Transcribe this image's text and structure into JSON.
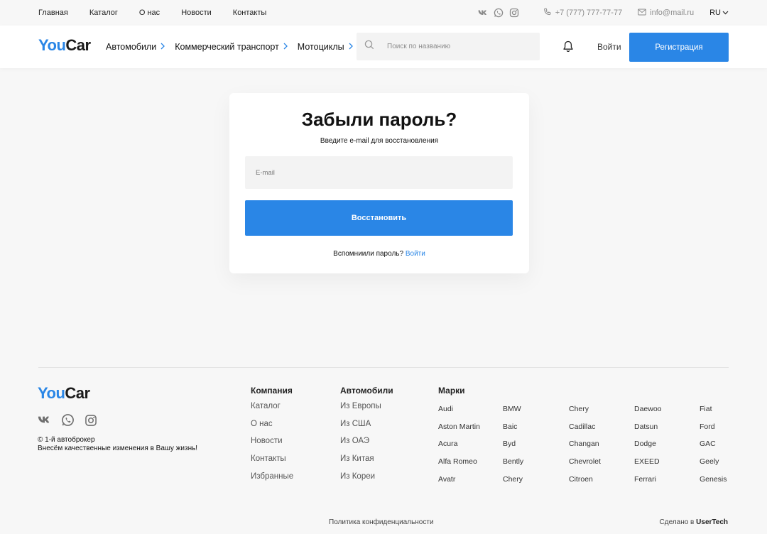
{
  "topbar": {
    "links": [
      "Главная",
      "Каталог",
      "О нас",
      "Новости",
      "Контакты"
    ],
    "social_icons": [
      "vk-icon",
      "whatsapp-icon",
      "instagram-icon"
    ],
    "phone": "+7 (777) 777-77-77",
    "email": "info@mail.ru",
    "language": "RU"
  },
  "header": {
    "logo": {
      "part1": "You",
      "part2": "Car"
    },
    "nav": [
      "Автомобили",
      "Коммерческий транспорт",
      "Мотоциклы"
    ],
    "search_placeholder": "Поиск по названию",
    "login": "Войти",
    "register": "Регистрация"
  },
  "card": {
    "title": "Забыли пароль?",
    "subtitle": "Введите e-mail для восстановления",
    "email_placeholder": "E-mail",
    "submit": "Восстановить",
    "remember_text": "Вспомниили пароль?",
    "remember_link": "Войти"
  },
  "footer": {
    "logo": {
      "part1": "You",
      "part2": "Car"
    },
    "copyright": "© 1-й автоброкер",
    "slogan": "Внесём качественные изменения в Вашу жизнь!",
    "company": {
      "title": "Компания",
      "items": [
        "Каталог",
        "О нас",
        "Новости",
        "Контакты",
        "Избранные"
      ]
    },
    "cars": {
      "title": "Автомобили",
      "items": [
        "Из Европы",
        "Из США",
        "Из ОАЭ",
        "Из Китая",
        "Из Кореи"
      ]
    },
    "brands": {
      "title": "Марки",
      "rows": [
        [
          "Audi",
          "BMW",
          "Chery",
          "Daewoo",
          "Fiat"
        ],
        [
          "Aston Martin",
          "Baic",
          "Cadillac",
          "Datsun",
          "Ford"
        ],
        [
          "Acura",
          "Byd",
          "Changan",
          "Dodge",
          "GAC"
        ],
        [
          "Alfa Romeo",
          "Bently",
          "Chevrolet",
          "EXEED",
          "Geely"
        ],
        [
          "Avatr",
          "Chery",
          "Citroen",
          "Ferrari",
          "Genesis"
        ]
      ]
    },
    "privacy": "Политика конфиденциальности",
    "made_by_prefix": "Сделано в",
    "made_by_name": "UserTech"
  },
  "colors": {
    "accent": "#2a86e6",
    "background": "#f7f7f7",
    "card": "#ffffff",
    "input": "#f3f3f3"
  }
}
